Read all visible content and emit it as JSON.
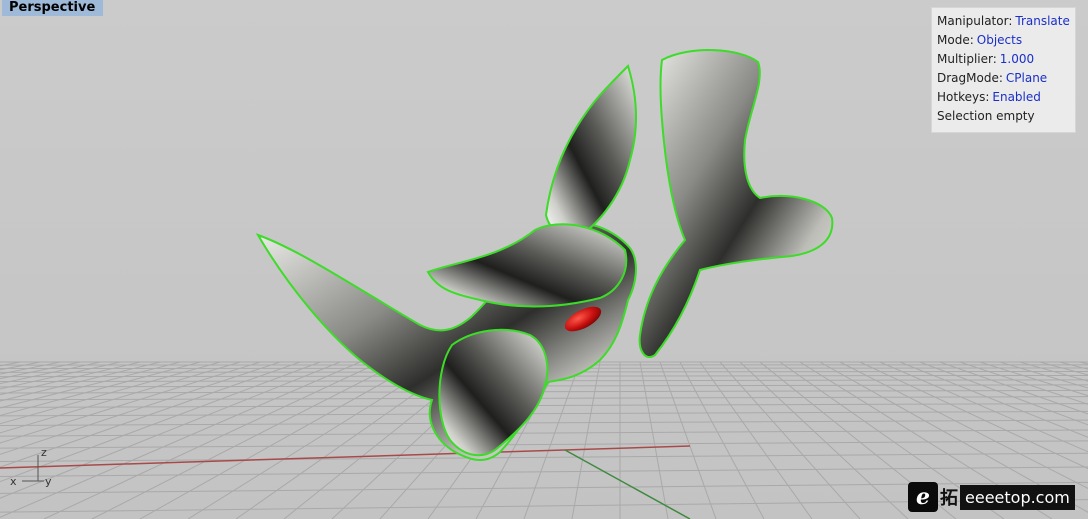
{
  "viewport": {
    "title": "Perspective"
  },
  "hud": {
    "rows": [
      {
        "label": "Manipulator:",
        "value": "Translate"
      },
      {
        "label": "Mode:",
        "value": "Objects"
      },
      {
        "label": "Multiplier:",
        "value": "1.000"
      },
      {
        "label": "DragMode:",
        "value": "CPlane"
      },
      {
        "label": "Hotkeys:",
        "value": "Enabled"
      },
      {
        "label": "Selection empty",
        "value": ""
      }
    ]
  },
  "axes": {
    "x": "x",
    "y": "y",
    "z": "z"
  },
  "watermark": {
    "badge": "e",
    "glyph": "拓",
    "text": "eeeetop.com"
  },
  "colors": {
    "grid": "#a9a9a9",
    "x_axis": "#a84a4a",
    "y_axis": "#3f8a3f",
    "highlight": "#3cdc28",
    "accent_red": "#cc1111"
  }
}
